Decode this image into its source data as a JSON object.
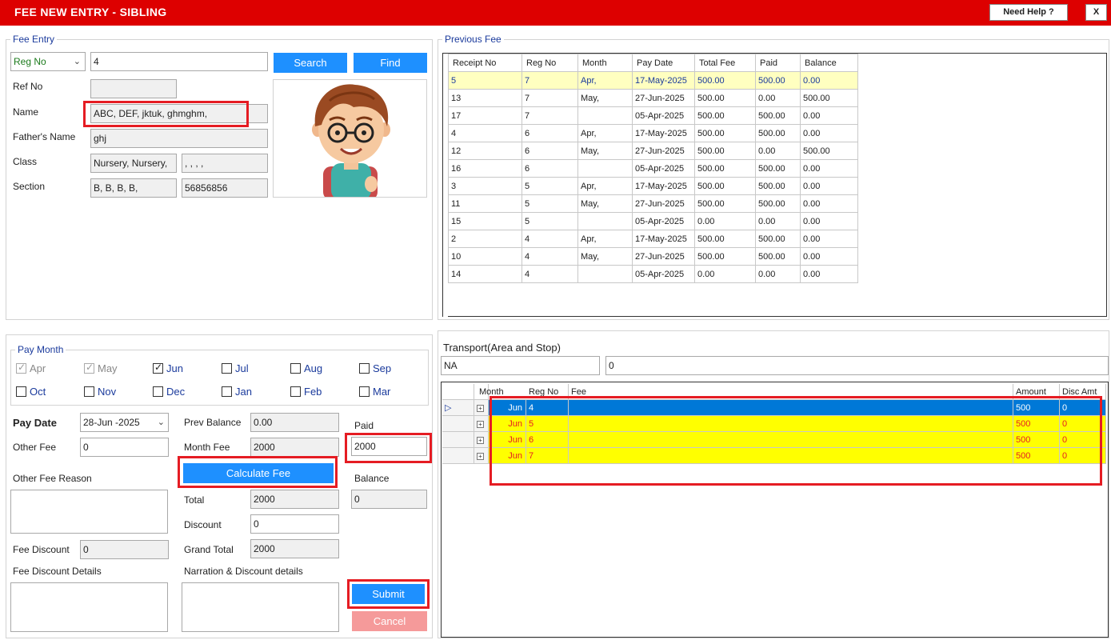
{
  "window": {
    "title": "FEE NEW ENTRY - SIBLING",
    "help_label": "Need Help ?",
    "close_label": "X"
  },
  "fee_entry": {
    "legend": "Fee Entry",
    "search_by": "Reg No",
    "search_value": "4",
    "search_label": "Search",
    "find_label": "Find",
    "ref_no_label": "Ref No",
    "ref_no": "",
    "name_label": "Name",
    "name": "ABC, DEF, jktuk, ghmghm,",
    "father_label": "Father's Name",
    "father": "ghj",
    "class_label": "Class",
    "class": "Nursery, Nursery,",
    "class2": ", , , ,",
    "section_label": "Section",
    "section": "B, B, B, B,",
    "phone": "56856856"
  },
  "previous_fee": {
    "legend": "Previous Fee",
    "columns": [
      "Receipt No",
      "Reg No",
      "Month",
      "Pay Date",
      "Total Fee",
      "Paid",
      "Balance"
    ],
    "rows": [
      [
        "5",
        "7",
        "Apr,",
        "17-May-2025",
        "500.00",
        "500.00",
        "0.00"
      ],
      [
        "13",
        "7",
        "May,",
        "27-Jun-2025",
        "500.00",
        "0.00",
        "500.00"
      ],
      [
        "17",
        "7",
        "",
        "05-Apr-2025",
        "500.00",
        "500.00",
        "0.00"
      ],
      [
        "4",
        "6",
        "Apr,",
        "17-May-2025",
        "500.00",
        "500.00",
        "0.00"
      ],
      [
        "12",
        "6",
        "May,",
        "27-Jun-2025",
        "500.00",
        "0.00",
        "500.00"
      ],
      [
        "16",
        "6",
        "",
        "05-Apr-2025",
        "500.00",
        "500.00",
        "0.00"
      ],
      [
        "3",
        "5",
        "Apr,",
        "17-May-2025",
        "500.00",
        "500.00",
        "0.00"
      ],
      [
        "11",
        "5",
        "May,",
        "27-Jun-2025",
        "500.00",
        "500.00",
        "0.00"
      ],
      [
        "15",
        "5",
        "",
        "05-Apr-2025",
        "0.00",
        "0.00",
        "0.00"
      ],
      [
        "2",
        "4",
        "Apr,",
        "17-May-2025",
        "500.00",
        "500.00",
        "0.00"
      ],
      [
        "10",
        "4",
        "May,",
        "27-Jun-2025",
        "500.00",
        "500.00",
        "0.00"
      ],
      [
        "14",
        "4",
        "",
        "05-Apr-2025",
        "0.00",
        "0.00",
        "0.00"
      ]
    ]
  },
  "pay_month": {
    "legend": "Pay Month",
    "months": [
      {
        "label": "Apr",
        "checked": true,
        "disabled": true
      },
      {
        "label": "May",
        "checked": true,
        "disabled": true
      },
      {
        "label": "Jun",
        "checked": true,
        "disabled": false
      },
      {
        "label": "Jul",
        "checked": false,
        "disabled": false
      },
      {
        "label": "Aug",
        "checked": false,
        "disabled": false
      },
      {
        "label": "Sep",
        "checked": false,
        "disabled": false
      },
      {
        "label": "Oct",
        "checked": false,
        "disabled": false
      },
      {
        "label": "Nov",
        "checked": false,
        "disabled": false
      },
      {
        "label": "Dec",
        "checked": false,
        "disabled": false
      },
      {
        "label": "Jan",
        "checked": false,
        "disabled": false
      },
      {
        "label": "Feb",
        "checked": false,
        "disabled": false
      },
      {
        "label": "Mar",
        "checked": false,
        "disabled": false
      }
    ]
  },
  "payment": {
    "pay_date_label": "Pay Date",
    "pay_date": "28-Jun -2025",
    "other_fee_label": "Other Fee",
    "other_fee": "0",
    "other_fee_reason_label": "Other Fee Reason",
    "other_fee_reason": "",
    "fee_discount_label": "Fee Discount",
    "fee_discount": "0",
    "fee_discount_details_label": "Fee Discount Details",
    "fee_discount_details": "",
    "prev_balance_label": "Prev Balance",
    "prev_balance": "0.00",
    "month_fee_label": "Month Fee",
    "month_fee": "2000",
    "calculate_label": "Calculate Fee",
    "total_label": "Total",
    "total": "2000",
    "discount_label": "Discount",
    "discount": "0",
    "grand_total_label": "Grand Total",
    "grand_total": "2000",
    "narration_label": "Narration & Discount  details",
    "narration": "",
    "paid_label": "Paid",
    "paid": "2000",
    "balance_label": "Balance",
    "balance": "0",
    "submit_label": "Submit",
    "cancel_label": "Cancel"
  },
  "transport": {
    "label": "Transport(Area and Stop)",
    "area": "NA",
    "stop": "0"
  },
  "fee_grid": {
    "columns": [
      "Month",
      "Reg No",
      "Fee",
      "Amount",
      "Disc Amt"
    ],
    "rows": [
      {
        "month": "Jun",
        "reg_no": "4",
        "fee": "",
        "amount": "500",
        "disc": "0"
      },
      {
        "month": "Jun",
        "reg_no": "5",
        "fee": "",
        "amount": "500",
        "disc": "0"
      },
      {
        "month": "Jun",
        "reg_no": "6",
        "fee": "",
        "amount": "500",
        "disc": "0"
      },
      {
        "month": "Jun",
        "reg_no": "7",
        "fee": "",
        "amount": "500",
        "disc": "0"
      }
    ]
  },
  "colors": {
    "title_bar": "#dd0000",
    "accent_blue": "#1e90ff",
    "highlight_red": "#e51c23",
    "row_yellow": "#ffff00",
    "row_selected": "#0078d7"
  }
}
